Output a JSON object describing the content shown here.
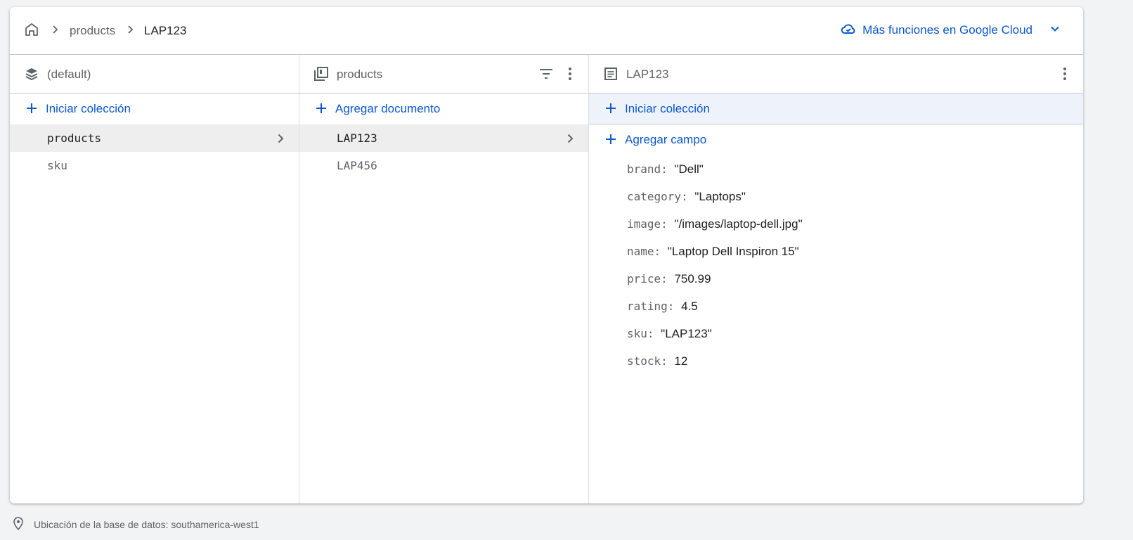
{
  "breadcrumb": {
    "items": [
      "products",
      "LAP123"
    ]
  },
  "header": {
    "cloud_link_label": "Más funciones en Google Cloud"
  },
  "panels": {
    "database": {
      "title": "(default)",
      "action_label": "Iniciar colección",
      "items": [
        "products",
        "sku"
      ]
    },
    "collection": {
      "title": "products",
      "action_label": "Agregar documento",
      "items": [
        "LAP123",
        "LAP456"
      ]
    },
    "document": {
      "title": "LAP123",
      "start_collection_label": "Iniciar colección",
      "add_field_label": "Agregar campo",
      "fields": [
        {
          "key": "brand:",
          "value": "\"Dell\""
        },
        {
          "key": "category:",
          "value": "\"Laptops\""
        },
        {
          "key": "image:",
          "value": "\"/images/laptop-dell.jpg\""
        },
        {
          "key": "name:",
          "value": "\"Laptop Dell Inspiron 15\""
        },
        {
          "key": "price:",
          "value": "750.99"
        },
        {
          "key": "rating:",
          "value": "4.5"
        },
        {
          "key": "sku:",
          "value": "\"LAP123\""
        },
        {
          "key": "stock:",
          "value": "12"
        }
      ]
    }
  },
  "footer": {
    "location_text": "Ubicación de la base de datos: southamerica-west1"
  },
  "colors": {
    "accent": "#0b57d0",
    "selected_row": "#eeeeee",
    "highlight_row": "#eef3fb"
  }
}
